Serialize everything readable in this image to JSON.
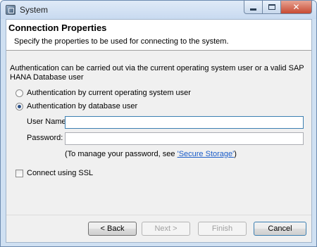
{
  "window": {
    "title": "System"
  },
  "header": {
    "title": "Connection Properties",
    "description": "Specify the properties to be used for connecting to the system."
  },
  "intro": "Authentication can be carried out via the current operating system user or a valid SAP HANA Database user",
  "auth_options": [
    {
      "label": "Authentication by current operating system user",
      "selected": false
    },
    {
      "label": "Authentication by database user",
      "selected": true
    }
  ],
  "fields": {
    "user_name": {
      "label": "User Name:",
      "value": ""
    },
    "password": {
      "label": "Password:",
      "value": ""
    }
  },
  "password_hint": {
    "prefix": "(To manage your password, see ",
    "link": "'Secure Storage'",
    "suffix": ")"
  },
  "ssl": {
    "label": "Connect using SSL",
    "checked": false
  },
  "buttons": {
    "back": "< Back",
    "next": "Next >",
    "finish": "Finish",
    "cancel": "Cancel"
  },
  "icons": {
    "app": "system-window-icon",
    "minimize": "minimize-icon",
    "maximize": "maximize-icon",
    "close": "close-icon"
  }
}
